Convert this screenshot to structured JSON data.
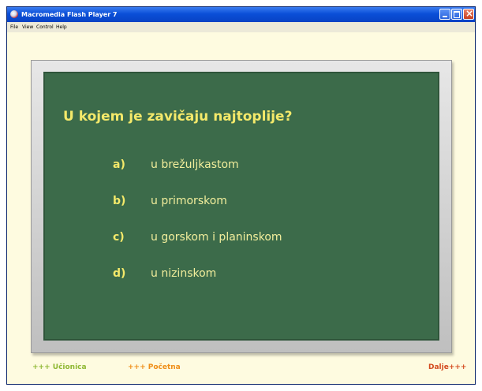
{
  "window": {
    "title": "Macromedia Flash Player 7"
  },
  "menubar": {
    "items": [
      "File",
      "View",
      "Control",
      "Help"
    ]
  },
  "quiz": {
    "question": "U kojem je zavičaju najtoplije?",
    "answers": [
      {
        "letter": "a)",
        "text": "u brežuljkastom"
      },
      {
        "letter": "b)",
        "text": "u primorskom"
      },
      {
        "letter": "c)",
        "text": "u gorskom i planinskom"
      },
      {
        "letter": "d)",
        "text": "u nizinskom"
      }
    ]
  },
  "footer": {
    "ucionica": "+++ Učionica",
    "pocetna": "+++ Početna",
    "dalje": "Dalje+++"
  },
  "colors": {
    "board": "#3c6b4a",
    "chalk_text": "#f4e96a",
    "background": "#fefbe0",
    "link_ucionica": "#8fb833",
    "link_pocetna": "#ef8f19",
    "link_dalje": "#d44b1f"
  }
}
